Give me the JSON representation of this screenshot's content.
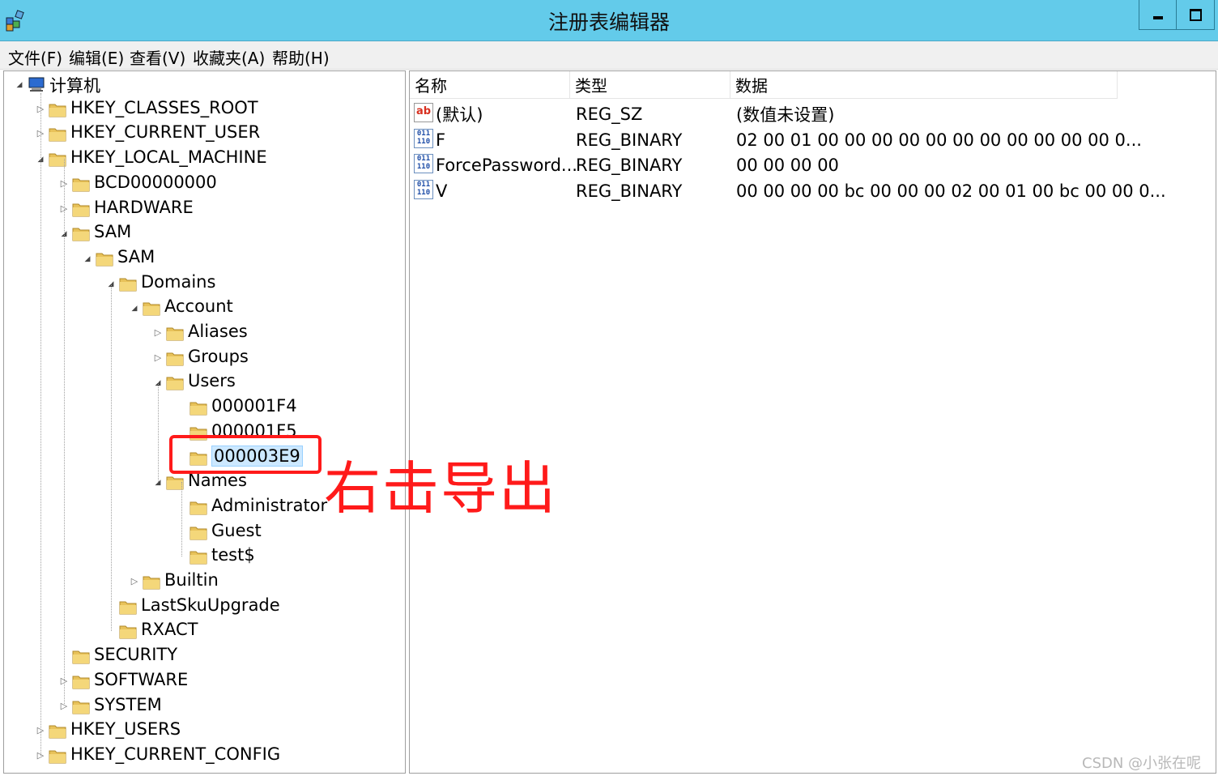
{
  "window": {
    "title": "注册表编辑器",
    "icon": "regedit-icon"
  },
  "menu": [
    "文件(F)",
    "编辑(E)",
    "查看(V)",
    "收藏夹(A)",
    "帮助(H)"
  ],
  "tree": {
    "root": "计算机",
    "nodes": [
      {
        "label": "HKEY_CLASSES_ROOT",
        "state": "collapsed"
      },
      {
        "label": "HKEY_CURRENT_USER",
        "state": "collapsed"
      },
      {
        "label": "HKEY_LOCAL_MACHINE",
        "state": "expanded"
      },
      {
        "label": "BCD00000000",
        "state": "collapsed"
      },
      {
        "label": "HARDWARE",
        "state": "collapsed"
      },
      {
        "label": "SAM",
        "state": "expanded"
      },
      {
        "label": "SAM",
        "state": "expanded"
      },
      {
        "label": "Domains",
        "state": "expanded"
      },
      {
        "label": "Account",
        "state": "expanded"
      },
      {
        "label": "Aliases",
        "state": "collapsed"
      },
      {
        "label": "Groups",
        "state": "collapsed"
      },
      {
        "label": "Users",
        "state": "expanded"
      },
      {
        "label": "000001F4",
        "state": "leaf"
      },
      {
        "label": "000001F5",
        "state": "leaf"
      },
      {
        "label": "000003E9",
        "state": "leaf",
        "selected": true
      },
      {
        "label": "Names",
        "state": "expanded"
      },
      {
        "label": "Administrator",
        "state": "leaf"
      },
      {
        "label": "Guest",
        "state": "leaf"
      },
      {
        "label": "test$",
        "state": "leaf"
      },
      {
        "label": "Builtin",
        "state": "collapsed"
      },
      {
        "label": "LastSkuUpgrade",
        "state": "leaf"
      },
      {
        "label": "RXACT",
        "state": "leaf"
      },
      {
        "label": "SECURITY",
        "state": "leaf"
      },
      {
        "label": "SOFTWARE",
        "state": "collapsed"
      },
      {
        "label": "SYSTEM",
        "state": "collapsed"
      },
      {
        "label": "HKEY_USERS",
        "state": "collapsed"
      },
      {
        "label": "HKEY_CURRENT_CONFIG",
        "state": "collapsed"
      }
    ]
  },
  "list": {
    "columns": [
      "名称",
      "类型",
      "数据"
    ],
    "rows": [
      {
        "icon": "string-value-icon",
        "name": "(默认)",
        "type": "REG_SZ",
        "data": "(数值未设置)"
      },
      {
        "icon": "binary-value-icon",
        "name": "F",
        "type": "REG_BINARY",
        "data": "02 00 01 00 00 00 00 00 00 00 00 00 00 00 0..."
      },
      {
        "icon": "binary-value-icon",
        "name": "ForcePassword...",
        "type": "REG_BINARY",
        "data": "00 00 00 00"
      },
      {
        "icon": "binary-value-icon",
        "name": "V",
        "type": "REG_BINARY",
        "data": "00 00 00 00 bc 00 00 00 02 00 01 00 bc 00 00 0..."
      }
    ]
  },
  "annotation": {
    "text": "右击导出",
    "color": "#ff1a1a"
  },
  "watermark": "CSDN @小张在呢",
  "colors": {
    "titlebar": "#63cbea",
    "selection": "#cce8ff"
  }
}
